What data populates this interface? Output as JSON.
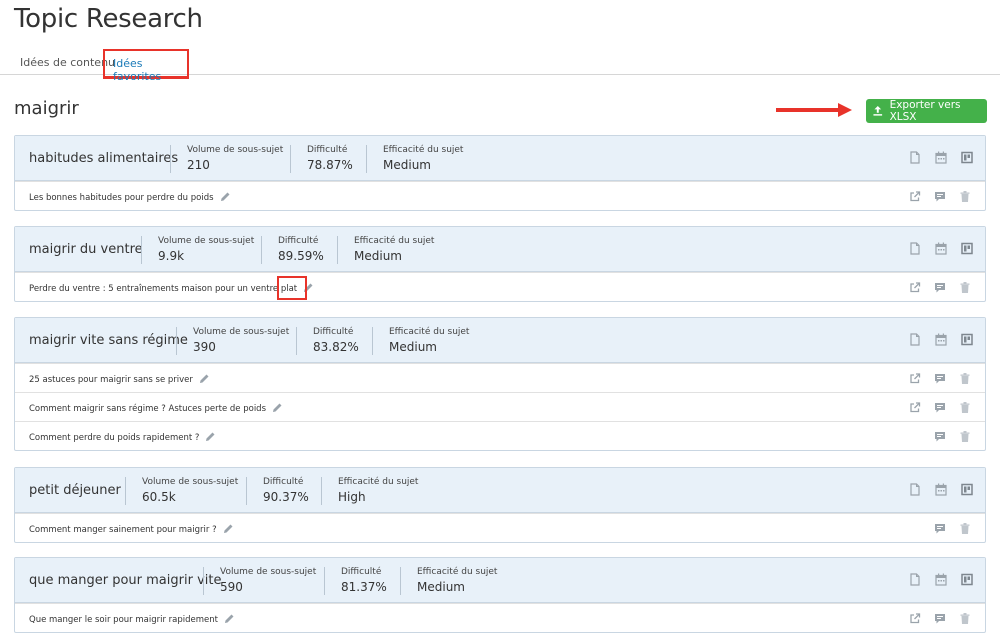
{
  "page": {
    "title": "Topic Research"
  },
  "tabs": [
    {
      "label": "Idées de contenu"
    },
    {
      "label": "Idées favorites",
      "active": true
    }
  ],
  "keyword": "maigrir",
  "export": {
    "label": "Exporter vers XLSX",
    "color": "#44b14a"
  },
  "metric_labels": {
    "volume": "Volume de sous-sujet",
    "difficulty": "Difficulté",
    "efficiency": "Efficacité du sujet"
  },
  "cards": [
    {
      "topic": "habitudes alimentaires",
      "volume": "210",
      "difficulty": "78.87%",
      "efficiency": "Medium",
      "ideas": [
        {
          "text": "Les bonnes habitudes pour perdre du poids",
          "external_link": true
        }
      ]
    },
    {
      "topic": "maigrir du ventre",
      "volume": "9.9k",
      "difficulty": "89.59%",
      "efficiency": "Medium",
      "ideas": [
        {
          "text": "Perdre du ventre : 5 entraînements maison pour un ventre plat",
          "external_link": true
        }
      ]
    },
    {
      "topic": "maigrir vite sans régime",
      "volume": "390",
      "difficulty": "83.82%",
      "efficiency": "Medium",
      "ideas": [
        {
          "text": "25 astuces pour maigrir sans se priver",
          "external_link": true
        },
        {
          "text": "Comment maigrir sans régime ? Astuces perte de poids",
          "external_link": true
        },
        {
          "text": "Comment perdre du poids rapidement ?",
          "external_link": false
        }
      ]
    },
    {
      "topic": "petit déjeuner",
      "volume": "60.5k",
      "difficulty": "90.37%",
      "efficiency": "High",
      "ideas": [
        {
          "text": "Comment manger sainement pour maigrir ?",
          "external_link": false
        }
      ]
    },
    {
      "topic": "que manger pour maigrir vite",
      "volume": "590",
      "difficulty": "81.37%",
      "efficiency": "Medium",
      "ideas": [
        {
          "text": "Que manger le soir pour maigrir rapidement",
          "external_link": true
        }
      ]
    }
  ],
  "colors": {
    "accent": "#1a7ab8",
    "highlight": "#e8332a",
    "card_header": "#e8f1f9",
    "icon": "#9aa3ab"
  }
}
